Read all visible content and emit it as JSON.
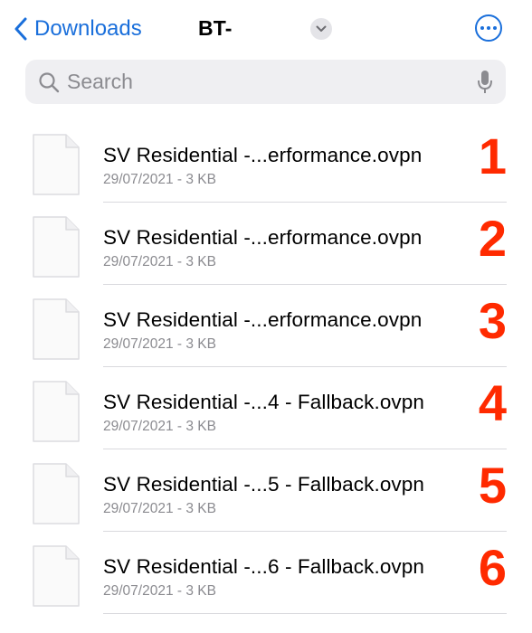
{
  "nav": {
    "back_label": "Downloads",
    "title": "BT-"
  },
  "search": {
    "placeholder": "Search"
  },
  "files": [
    {
      "name": "SV Residential -...erformance.ovpn",
      "date": "29/07/2021",
      "size": "3 KB",
      "meta": "29/07/2021 - 3 KB",
      "annotation": "1"
    },
    {
      "name": "SV Residential -...erformance.ovpn",
      "date": "29/07/2021",
      "size": "3 KB",
      "meta": "29/07/2021 - 3 KB",
      "annotation": "2"
    },
    {
      "name": "SV Residential -...erformance.ovpn",
      "date": "29/07/2021",
      "size": "3 KB",
      "meta": "29/07/2021 - 3 KB",
      "annotation": "3"
    },
    {
      "name": "SV Residential -...4 - Fallback.ovpn",
      "date": "29/07/2021",
      "size": "3 KB",
      "meta": "29/07/2021 - 3 KB",
      "annotation": "4"
    },
    {
      "name": "SV Residential -...5 - Fallback.ovpn",
      "date": "29/07/2021",
      "size": "3 KB",
      "meta": "29/07/2021 - 3 KB",
      "annotation": "5"
    },
    {
      "name": "SV Residential -...6 - Fallback.ovpn",
      "date": "29/07/2021",
      "size": "3 KB",
      "meta": "29/07/2021 - 3 KB",
      "annotation": "6"
    }
  ],
  "colors": {
    "accent": "#1a6fdb",
    "annotation": "#ff2a00",
    "secondary_text": "#8b8b90",
    "search_bg": "#efeff2"
  },
  "icons": {
    "back": "chevron-left-icon",
    "title_menu": "chevron-down-icon",
    "more": "ellipsis-circle-icon",
    "search": "magnifying-glass-icon",
    "dictation": "microphone-icon",
    "file": "document-icon"
  }
}
